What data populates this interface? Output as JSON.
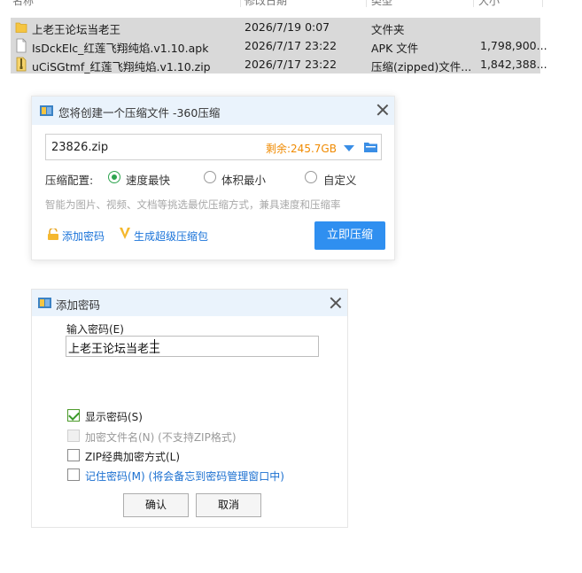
{
  "explorer": {
    "columns": [
      "名称",
      "修改日期",
      "类型",
      "大小"
    ],
    "files": [
      {
        "name": "上老王论坛当老王",
        "date": "2026/7/19 0:07",
        "type": "文件夹",
        "size": "",
        "icon": "folder-icon"
      },
      {
        "name": "IsDckElc_红莲飞翔纯焰.v1.10.apk",
        "date": "2026/7/17 23:22",
        "type": "APK 文件",
        "size": "1,798,900...",
        "icon": "file-icon"
      },
      {
        "name": "uCiSGtmf_红莲飞翔纯焰.v1.10.zip",
        "date": "2026/7/17 23:22",
        "type": "压缩(zipped)文件...",
        "size": "1,842,388...",
        "icon": "zip-icon"
      }
    ]
  },
  "compress_dialog": {
    "title": "您将创建一个压缩文件 -360压缩",
    "filename": "23826.zip",
    "free_space": "剩余:245.7GB",
    "config_label": "压缩配置:",
    "options": [
      "速度最快",
      "体积最小",
      "自定义"
    ],
    "selected_option": "速度最快",
    "hint": "智能为图片、视频、文档等挑选最优压缩方式，兼具速度和压缩率",
    "add_password": "添加密码",
    "super_package": "生成超级压缩包",
    "compress_now": "立即压缩",
    "accent_color": "#2f8ff0"
  },
  "password_dialog": {
    "title": "添加密码",
    "input_label": "输入密码(E)",
    "password_value": "上老王论坛当老王",
    "checkboxes": [
      {
        "label": "显示密码(S)",
        "checked": true,
        "disabled": false
      },
      {
        "label": "加密文件名(N) (不支持ZIP格式)",
        "checked": false,
        "disabled": true
      },
      {
        "label": "ZIP经典加密方式(L)",
        "checked": false,
        "disabled": false
      },
      {
        "label": "记住密码(M) (将会备忘到密码管理窗口中)",
        "checked": false,
        "disabled": false
      }
    ],
    "ok_label": "确认",
    "cancel_label": "取消"
  }
}
